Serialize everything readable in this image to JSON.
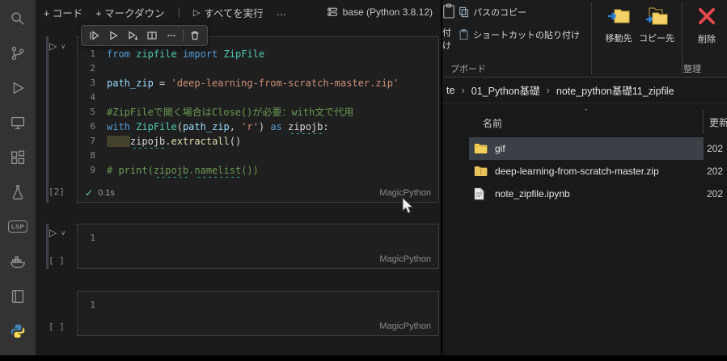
{
  "activity_bar": {
    "icons": [
      {
        "name": "search-icon"
      },
      {
        "name": "source-control-icon"
      },
      {
        "name": "run-debug-icon"
      },
      {
        "name": "remote-explorer-icon"
      },
      {
        "name": "extensions-icon"
      },
      {
        "name": "testing-icon"
      },
      {
        "name": "lsp-icon",
        "label": "LSP"
      },
      {
        "name": "docker-icon"
      },
      {
        "name": "notebook-icon"
      },
      {
        "name": "python-icon"
      }
    ]
  },
  "notebook": {
    "toolbar": {
      "add_code": "+ コード",
      "add_markdown": "+ マークダウン",
      "run_all": "すべてを実行",
      "more": "…",
      "kernel": "base (Python 3.8.12)"
    },
    "cell_toolbar_icons": [
      "run-above-icon",
      "run-cell-icon",
      "run-below-icon",
      "split-cell-icon",
      "more-actions-icon",
      "delete-cell-icon"
    ],
    "cells": [
      {
        "execution_label": "[2]",
        "status_check": "✓",
        "duration": "0.1s",
        "language": "MagicPython",
        "lines": [
          {
            "num": "1",
            "tokens": [
              {
                "t": "from",
                "c": "kw"
              },
              {
                "t": " ",
                "c": "pl"
              },
              {
                "t": "zipfile",
                "c": "cls"
              },
              {
                "t": " ",
                "c": "pl"
              },
              {
                "t": "import",
                "c": "kw"
              },
              {
                "t": " ",
                "c": "pl"
              },
              {
                "t": "ZipFile",
                "c": "cls"
              }
            ]
          },
          {
            "num": "2",
            "tokens": []
          },
          {
            "num": "3",
            "tokens": [
              {
                "t": "path_zip",
                "c": "var"
              },
              {
                "t": " = ",
                "c": "pl"
              },
              {
                "t": "'deep-learning-from-scratch-master.zip'",
                "c": "str"
              }
            ]
          },
          {
            "num": "4",
            "tokens": []
          },
          {
            "num": "5",
            "tokens": [
              {
                "t": "#ZipFileで開く場合はClose()が必要：with文で代用",
                "c": "com"
              }
            ]
          },
          {
            "num": "6",
            "tokens": [
              {
                "t": "with",
                "c": "kw"
              },
              {
                "t": " ",
                "c": "pl"
              },
              {
                "t": "ZipFile",
                "c": "cls"
              },
              {
                "t": "(",
                "c": "pl"
              },
              {
                "t": "path_zip",
                "c": "var"
              },
              {
                "t": ", ",
                "c": "pl"
              },
              {
                "t": "'r'",
                "c": "str"
              },
              {
                "t": ") ",
                "c": "pl"
              },
              {
                "t": "as",
                "c": "kw"
              },
              {
                "t": " ",
                "c": "pl"
              },
              {
                "t": "zipojb",
                "c": "pl sq"
              },
              {
                "t": ":",
                "c": "pl"
              }
            ]
          },
          {
            "num": "7",
            "tokens": [
              {
                "t": "    ",
                "c": "pl ind"
              },
              {
                "t": "zipojb",
                "c": "pl sq"
              },
              {
                "t": ".",
                "c": "pl"
              },
              {
                "t": "extractall",
                "c": "fn"
              },
              {
                "t": "()",
                "c": "pl"
              }
            ]
          },
          {
            "num": "8",
            "tokens": []
          },
          {
            "num": "9",
            "tokens": [
              {
                "t": "# print(",
                "c": "com"
              },
              {
                "t": "zipojb",
                "c": "com sq"
              },
              {
                "t": ".",
                "c": "com"
              },
              {
                "t": "namelist",
                "c": "com sq"
              },
              {
                "t": "())",
                "c": "com"
              }
            ]
          }
        ]
      },
      {
        "execution_label": "[ ]",
        "language": "MagicPython",
        "lines": [
          {
            "num": "1",
            "tokens": []
          }
        ]
      },
      {
        "execution_label": "[ ]",
        "language": "MagicPython",
        "lines": [
          {
            "num": "1",
            "tokens": []
          }
        ]
      }
    ]
  },
  "explorer": {
    "ribbon": {
      "paste_fragment": "付け",
      "copy_path": "パスのコピー",
      "paste_shortcut": "ショートカットの貼り付け",
      "move_to": "移動先",
      "copy_to": "コピー先",
      "delete": "削除",
      "group_clipboard": "プボード",
      "group_organize": "整理"
    },
    "breadcrumb": [
      "te",
      "01_Python基礎",
      "note_python基礎11_zipfile"
    ],
    "list": {
      "col_name": "名前",
      "col_modified": "更新",
      "rows": [
        {
          "name": "gif",
          "icon": "folder-icon",
          "date": "202",
          "selected": true
        },
        {
          "name": "deep-learning-from-scratch-master.zip",
          "icon": "zip-icon",
          "date": "202",
          "selected": false
        },
        {
          "name": "note_zipfile.ipynb",
          "icon": "ipynb-file-icon",
          "date": "202",
          "selected": false
        }
      ]
    }
  },
  "colors": {
    "selection_row": "#3a4046",
    "folder_yellow": "#f3ce58",
    "delete_red": "#e5484d",
    "check_green": "#73c991"
  }
}
